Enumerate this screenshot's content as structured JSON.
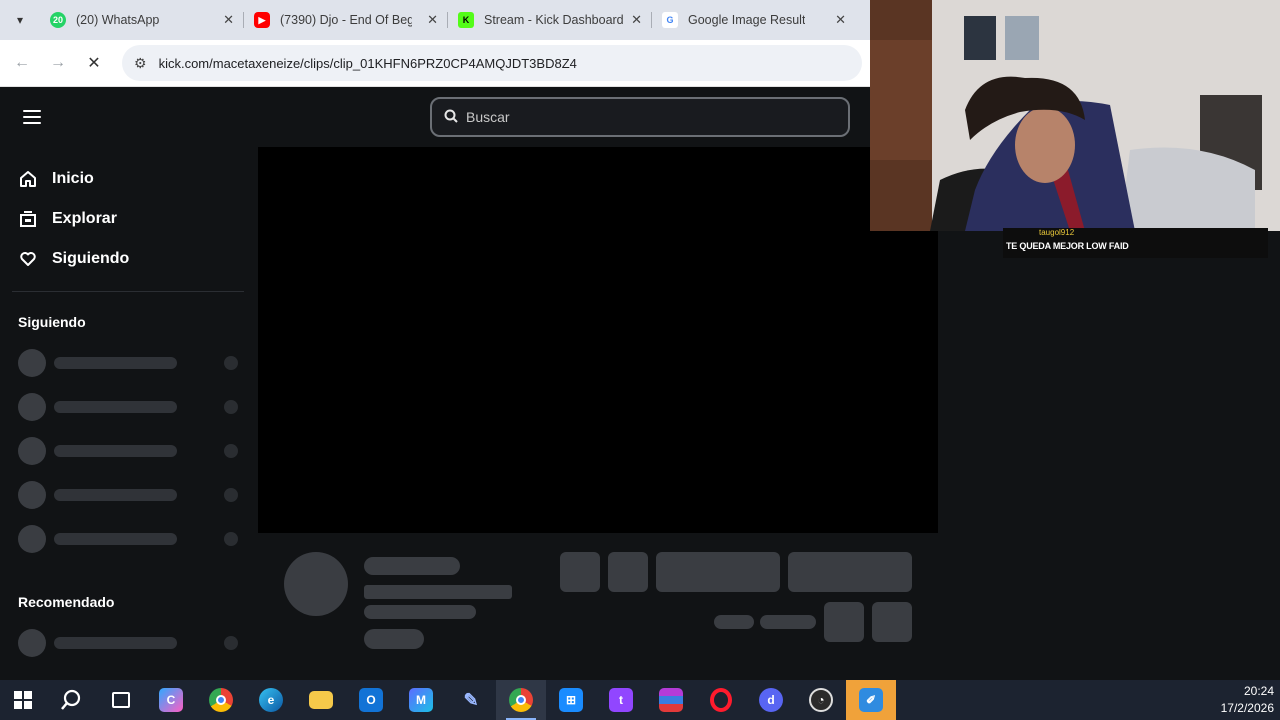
{
  "browser": {
    "tabs": [
      {
        "label": "(20) WhatsApp",
        "favicon": "whatsapp-icon",
        "badge": "20",
        "color": "#25d366"
      },
      {
        "label": "(7390) Djo - End Of Begi",
        "favicon": "youtube-icon",
        "color": "#ff0000"
      },
      {
        "label": "Stream - Kick Dashboard",
        "favicon": "kick-icon",
        "badge": "K",
        "color": "#53fc18"
      },
      {
        "label": "Google Image Result",
        "favicon": "google-icon",
        "badge": "G",
        "color": "#4285f4"
      }
    ],
    "url": "kick.com/macetaxeneize/clips/clip_01KHFN6PRZ0CP4AMQJDT3BD8Z4"
  },
  "kick": {
    "search_placeholder": "Buscar",
    "nav": [
      {
        "label": "Inicio",
        "icon": "home-icon"
      },
      {
        "label": "Explorar",
        "icon": "explore-icon"
      },
      {
        "label": "Siguiendo",
        "icon": "heart-icon"
      }
    ],
    "following_title": "Siguiendo",
    "recommended_title": "Recomendado"
  },
  "overlay": {
    "chat_user": "taugol912",
    "chat_message": "TE QUEDA MEJOR LOW FAID"
  },
  "taskbar": {
    "time": "20:24",
    "date": "17/2/2026"
  }
}
